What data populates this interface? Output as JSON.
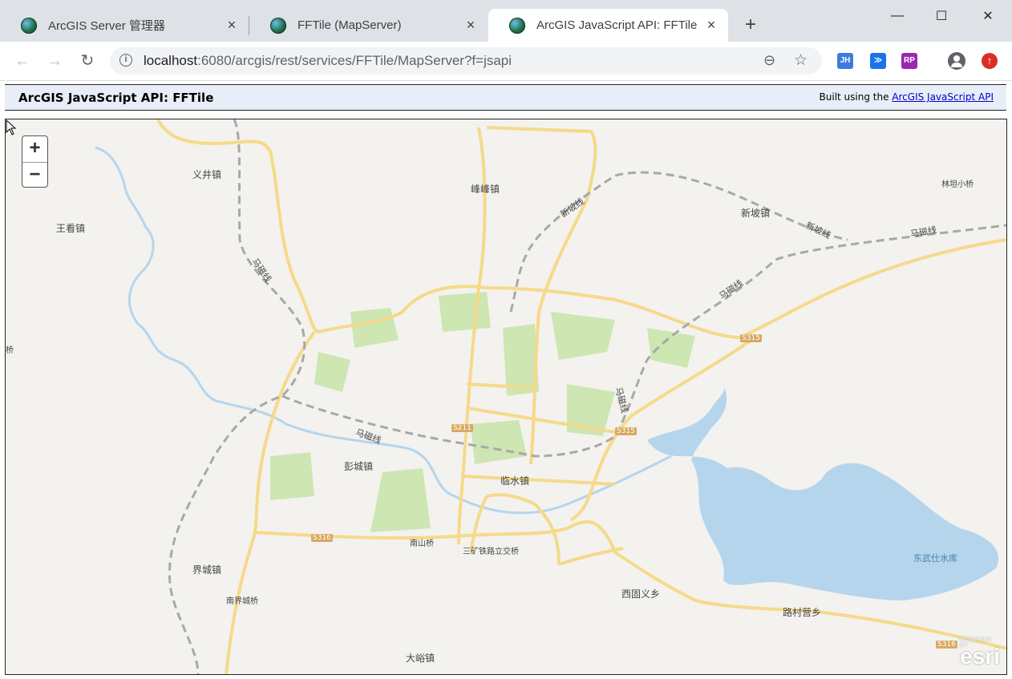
{
  "browser": {
    "tabs": [
      {
        "title": "ArcGIS Server 管理器",
        "active": false
      },
      {
        "title": "FFTile (MapServer)",
        "active": false
      },
      {
        "title": "ArcGIS JavaScript API: FFTile",
        "active": true
      }
    ],
    "new_tab": "+",
    "window_controls": {
      "minimize": "—",
      "maximize": "☐",
      "close": "✕"
    },
    "nav": {
      "back": "←",
      "forward": "→",
      "reload": "↻"
    },
    "address": {
      "host": "localhost",
      "rest": ":6080/arcgis/rest/services/FFTile/MapServer?f=jsapi"
    },
    "extensions": [
      {
        "name": "jh-extension-icon",
        "label": "JH",
        "color": "#3d7be0"
      },
      {
        "name": "save-extension-icon",
        "label": "≫",
        "color": "#1a73e8"
      },
      {
        "name": "rp-extension-icon",
        "label": "RP",
        "color": "#9b27b0"
      }
    ]
  },
  "page": {
    "header_title": "ArcGIS JavaScript API: FFTile",
    "built_prefix": "Built using the",
    "built_link": "ArcGIS JavaScript API"
  },
  "map": {
    "zoom_in": "+",
    "zoom_out": "−",
    "attribution": "esri",
    "attribution_small": "POWERED BY",
    "labels": {
      "yijing": "义井镇",
      "fengfeng": "峰峰镇",
      "wangkan": "王看镇",
      "xinpo_zhen": "新坡镇",
      "linqiao": "林坦小桥",
      "xinpo_line1": "新坡线",
      "xinpo_line2": "新坡线",
      "maci_line1": "马磁线",
      "maci_line2": "马磁线",
      "maci_line3": "马磁线",
      "maci_line4": "马磁线",
      "maci_line5": "马磁线",
      "pengcheng": "彭城镇",
      "linshui": "临水镇",
      "nanshanqiao": "南山桥",
      "sankuang": "三矿铁路立交桥",
      "jiecheng": "界城镇",
      "nanjiecheng": "南界城桥",
      "xiguyi": "西固义乡",
      "lucunying": "路村营乡",
      "dayu": "大峪镇",
      "dongwushi": "东武仕水库",
      "qiao_edge": "桥",
      "s315a": "S315",
      "s315b": "S315",
      "s211": "S211",
      "s316a": "S316",
      "s316b": "S316"
    }
  }
}
